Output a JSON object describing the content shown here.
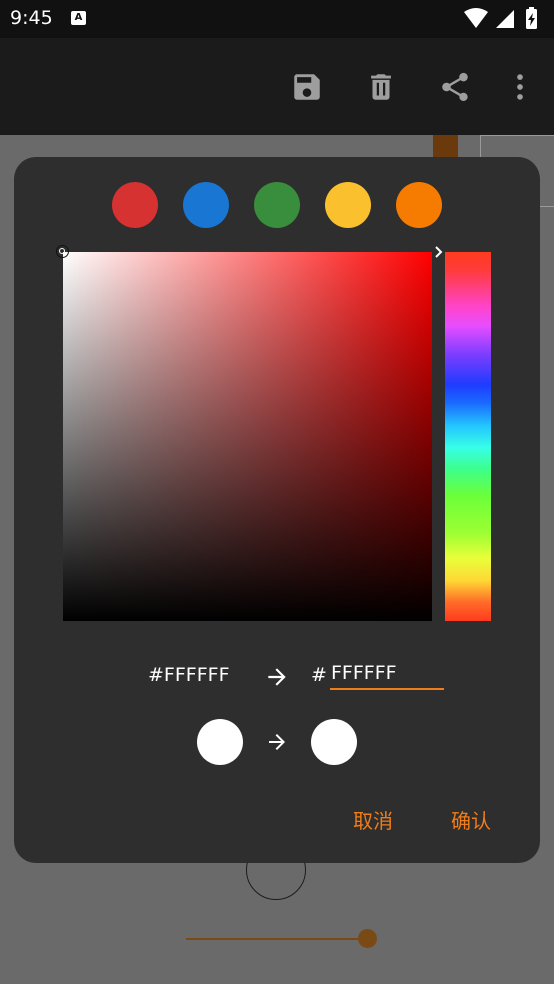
{
  "status_bar": {
    "time": "9:45",
    "notification_icon": "A"
  },
  "toolbar": {
    "icons": [
      "save-icon",
      "delete-icon",
      "share-icon",
      "more-vert-icon"
    ]
  },
  "dialog": {
    "presets": [
      {
        "color": "#d63232"
      },
      {
        "color": "#1976d2"
      },
      {
        "color": "#388e3c"
      },
      {
        "color": "#fbc02d"
      },
      {
        "color": "#f57c00"
      }
    ],
    "picker": {
      "hue_color": "#ff0000",
      "saturation": 0,
      "value": 1
    },
    "old_hex": "#FFFFFF",
    "hash": "#",
    "new_hex_value": "FFFFFF",
    "old_color": "#ffffff",
    "new_color": "#ffffff",
    "cancel_label": "取消",
    "confirm_label": "确认",
    "accent_color": "#ef7d1a"
  }
}
